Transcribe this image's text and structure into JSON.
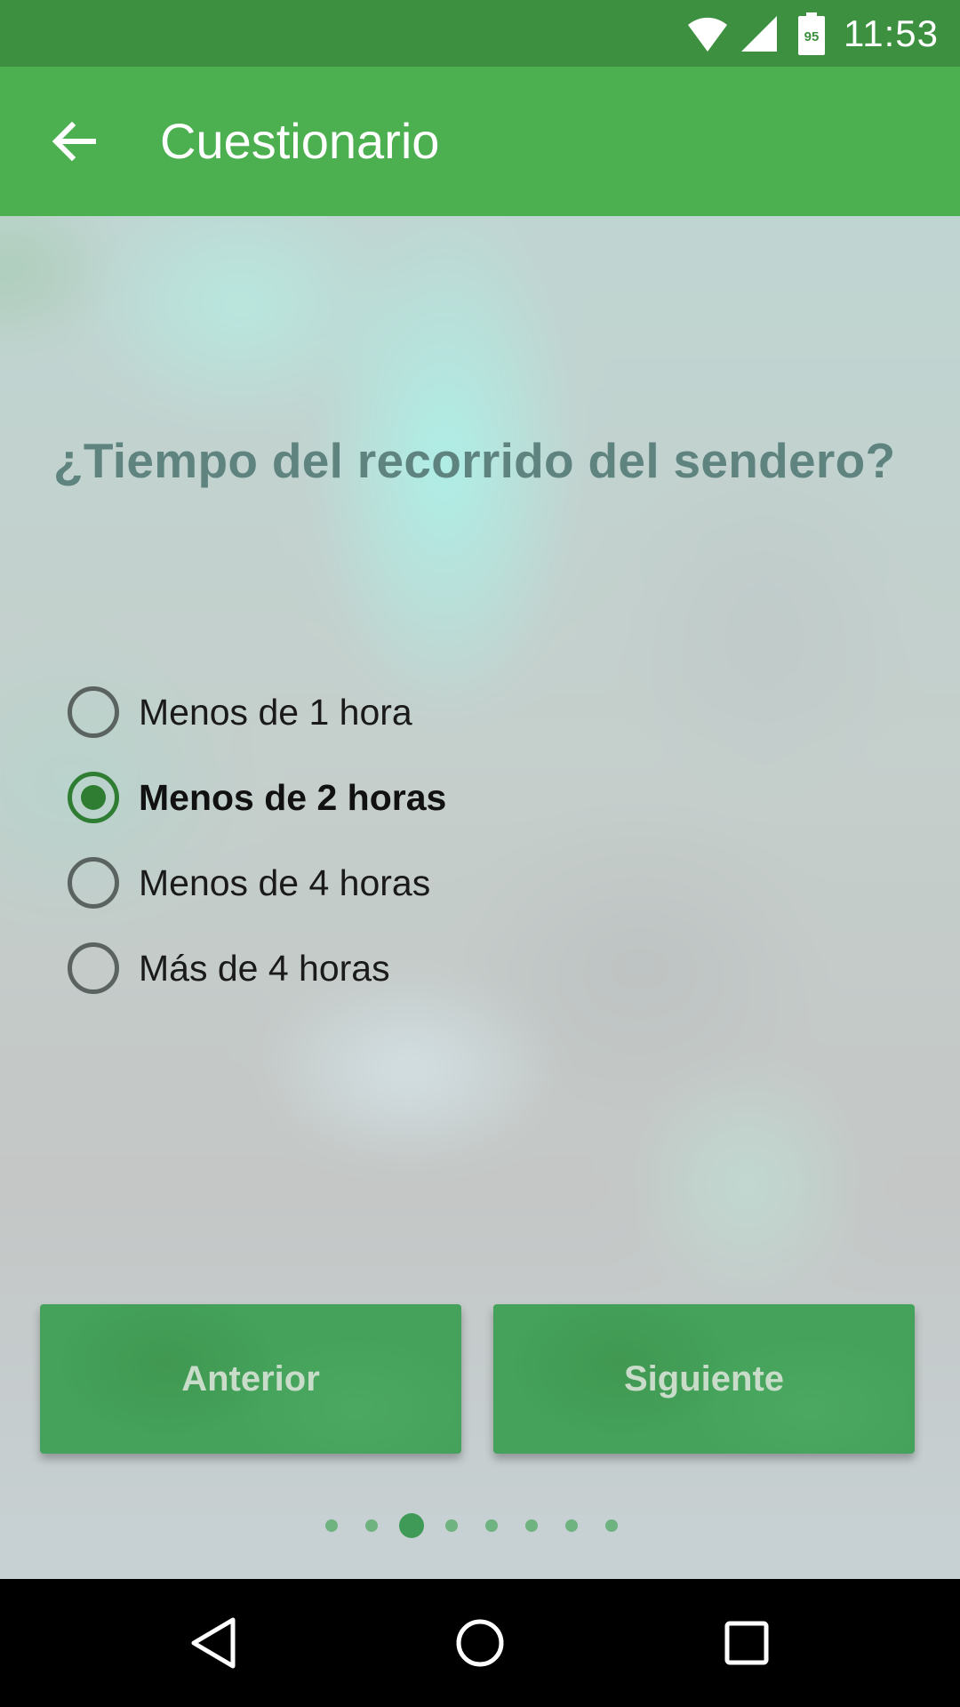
{
  "status_bar": {
    "time": "11:53",
    "battery_level": "95",
    "icons": [
      "wifi-icon",
      "cell-signal-icon",
      "battery-icon"
    ]
  },
  "app_bar": {
    "title": "Cuestionario",
    "back_icon": "arrow-back-icon"
  },
  "question": {
    "text": "¿Tiempo del recorrido del sendero?",
    "options": [
      {
        "label": "Menos de 1 hora",
        "selected": false
      },
      {
        "label": "Menos de 2 horas",
        "selected": true
      },
      {
        "label": "Menos de 4 horas",
        "selected": false
      },
      {
        "label": "Más de 4 horas",
        "selected": false
      }
    ]
  },
  "buttons": {
    "previous": "Anterior",
    "next": "Siguiente"
  },
  "pager": {
    "total": 8,
    "current": 3
  },
  "nav_bar": {
    "icons": [
      "nav-back-icon",
      "nav-home-icon",
      "nav-recents-icon"
    ]
  },
  "colors": {
    "status_bar": "#3c903f",
    "app_bar": "#4caf50",
    "accent": "#2e7d32",
    "button": "#44a25a"
  }
}
